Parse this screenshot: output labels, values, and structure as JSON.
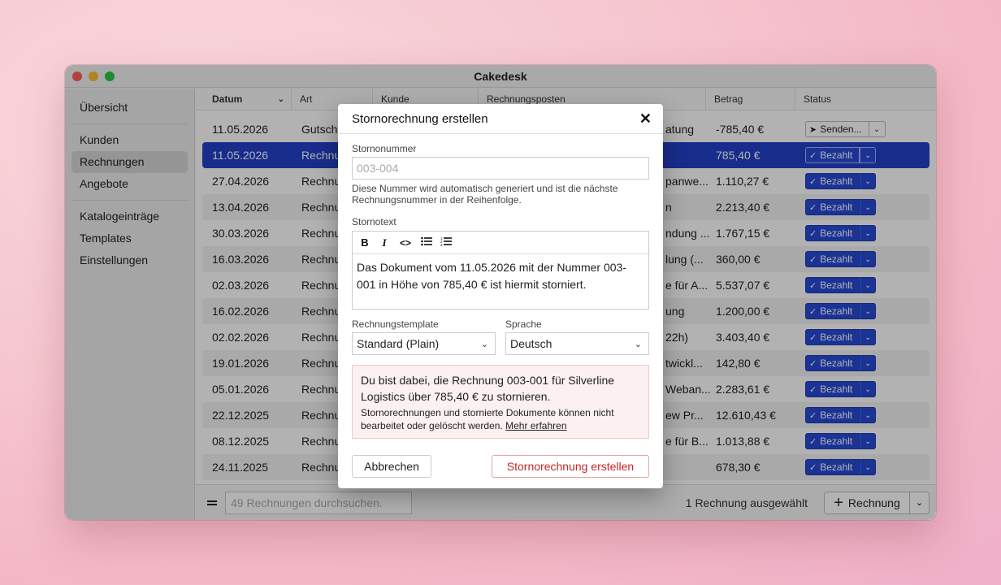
{
  "window": {
    "title": "Cakedesk"
  },
  "sidebar": {
    "items": [
      {
        "label": "Übersicht"
      },
      {
        "label": "Kunden"
      },
      {
        "label": "Rechnungen"
      },
      {
        "label": "Angebote"
      },
      {
        "label": "Katalogeinträge"
      },
      {
        "label": "Templates"
      },
      {
        "label": "Einstellungen"
      }
    ]
  },
  "table": {
    "columns": [
      "Datum",
      "Art",
      "Kunde",
      "Rechnungsposten",
      "Betrag",
      "Status"
    ],
    "rows": [
      {
        "date": "11.05.2026",
        "art": "Gutsch",
        "pos": "atung",
        "amount": "-785,40 €",
        "status": "Senden..."
      },
      {
        "date": "11.05.2026",
        "art": "Rechnu",
        "pos": "",
        "amount": "785,40 €",
        "status": "Bezahlt"
      },
      {
        "date": "27.04.2026",
        "art": "Rechnu",
        "pos": "panwe...",
        "amount": "1.110,27 €",
        "status": "Bezahlt"
      },
      {
        "date": "13.04.2026",
        "art": "Rechnu",
        "pos": "n",
        "amount": "2.213,40 €",
        "status": "Bezahlt"
      },
      {
        "date": "30.03.2026",
        "art": "Rechnu",
        "pos": "ndung ...",
        "amount": "1.767,15 €",
        "status": "Bezahlt"
      },
      {
        "date": "16.03.2026",
        "art": "Rechnu",
        "pos": "lung (...",
        "amount": "360,00 €",
        "status": "Bezahlt"
      },
      {
        "date": "02.03.2026",
        "art": "Rechnu",
        "pos": "e für A...",
        "amount": "5.537,07 €",
        "status": "Bezahlt"
      },
      {
        "date": "16.02.2026",
        "art": "Rechnu",
        "pos": "ung",
        "amount": "1.200,00 €",
        "status": "Bezahlt"
      },
      {
        "date": "02.02.2026",
        "art": "Rechnu",
        "pos": "22h)",
        "amount": "3.403,40 €",
        "status": "Bezahlt"
      },
      {
        "date": "19.01.2026",
        "art": "Rechnu",
        "pos": "twickl...",
        "amount": "142,80 €",
        "status": "Bezahlt"
      },
      {
        "date": "05.01.2026",
        "art": "Rechnu",
        "pos": "Weban...",
        "amount": "2.283,61 €",
        "status": "Bezahlt"
      },
      {
        "date": "22.12.2025",
        "art": "Rechnu",
        "pos": "ew Pr...",
        "amount": "12.610,43 €",
        "status": "Bezahlt"
      },
      {
        "date": "08.12.2025",
        "art": "Rechnu",
        "pos": "e für B...",
        "amount": "1.013,88 €",
        "status": "Bezahlt"
      },
      {
        "date": "24.11.2025",
        "art": "Rechnu",
        "pos": "",
        "amount": "678,30 €",
        "status": "Bezahlt"
      }
    ]
  },
  "footer": {
    "search_placeholder": "49 Rechnungen durchsuchen.",
    "selection": "1 Rechnung ausgewählt",
    "new_button": "Rechnung"
  },
  "dialog": {
    "title": "Stornorechnung erstellen",
    "number_label": "Stornonummer",
    "number_placeholder": "003-004",
    "number_hint": "Diese Nummer wird automatisch generiert und ist die nächste Rechnungsnummer in der Reihenfolge.",
    "text_label": "Stornotext",
    "toolbar": [
      "B",
      "I",
      "<>",
      "bullet-list",
      "numbered-list"
    ],
    "text": "Das Dokument vom 11.05.2026 mit der Nummer 003-001 in Höhe von 785,40 € ist hiermit storniert.",
    "template_label": "Rechnungstemplate",
    "template_value": "Standard (Plain)",
    "language_label": "Sprache",
    "language_value": "Deutsch",
    "warning_main": "Du bist dabei, die Rechnung 003-001 für Silverline Logistics über 785,40 € zu stornieren.",
    "warning_sub": "Stornorechnungen und stornierte Dokumente können nicht bearbeitet oder gelöscht werden.",
    "warning_link": "Mehr erfahren",
    "cancel": "Abbrechen",
    "confirm": "Stornorechnung erstellen"
  },
  "colors": {
    "selection": "#2340c9",
    "status_paid": "#2749d6",
    "danger": "#c0262b"
  }
}
